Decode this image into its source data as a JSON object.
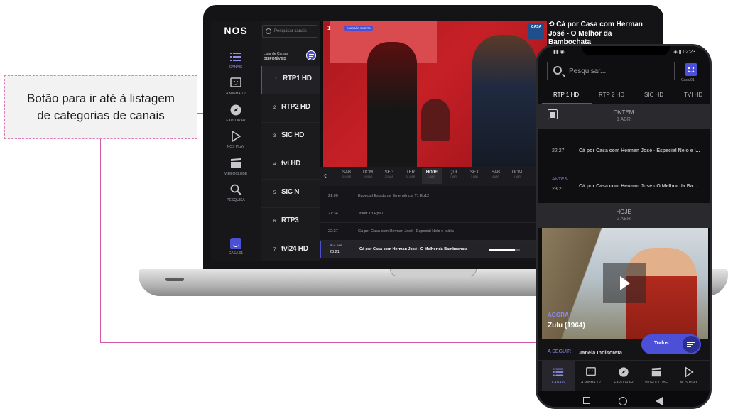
{
  "callout": {
    "text": "Botão para ir até à listagem\nde categorias de canais"
  },
  "laptop": {
    "brand": "NOS",
    "search_placeholder": "Pesquisar canais",
    "rail": [
      {
        "label": "CANAIS",
        "icon": "list-icon",
        "active": true
      },
      {
        "label": "A MINHA TV",
        "icon": "tv-face-icon",
        "active": false
      },
      {
        "label": "EXPLORAR",
        "icon": "compass-icon",
        "active": false
      },
      {
        "label": "NOS PLAY",
        "icon": "play-icon",
        "active": false
      },
      {
        "label": "VIDEOCLUBE",
        "icon": "clapper-icon",
        "active": false
      },
      {
        "label": "PESQUISA",
        "icon": "search-icon",
        "active": false
      }
    ],
    "profile_label": "CASA 01",
    "list_title": "Lista de Canais",
    "list_subtitle": "DISPONÍVEIS",
    "channels": [
      {
        "num": "1",
        "name": "RTP1 HD"
      },
      {
        "num": "2",
        "name": "RTP2 HD"
      },
      {
        "num": "3",
        "name": "SIC HD"
      },
      {
        "num": "4",
        "name": "tvi HD"
      },
      {
        "num": "5",
        "name": "SIC N"
      },
      {
        "num": "6",
        "name": "RTP3"
      },
      {
        "num": "7",
        "name": "tvi24 HD"
      }
    ],
    "video": {
      "channel_num": "1",
      "chip": "EMISSÃO DIRETA",
      "logo": "CASA"
    },
    "days": [
      {
        "name": "SÁB",
        "date": "28 MAR"
      },
      {
        "name": "DOM",
        "date": "29 MAR"
      },
      {
        "name": "SEG",
        "date": "30 MAR"
      },
      {
        "name": "TER",
        "date": "31 MAR"
      },
      {
        "name": "HOJE",
        "date": "1 ABR"
      },
      {
        "name": "QUI",
        "date": "2 ABR"
      },
      {
        "name": "SEX",
        "date": "3 ABR"
      },
      {
        "name": "SÁB",
        "date": "4 ABR"
      },
      {
        "name": "DOM",
        "date": "5 ABR"
      }
    ],
    "guide": [
      {
        "time": "21:00",
        "title": "Especial Estado de Emergência   T1 Ep12"
      },
      {
        "time": "21:34",
        "title": "Joker   T3 Ep91"
      },
      {
        "time": "22:27",
        "title": "Cá por Casa com Herman José - Especial Nelo e Idália"
      }
    ],
    "now": {
      "label": "AGORA",
      "time": "23:21",
      "title": "Cá por Casa com Herman José - O Melhor da Bambochata",
      "progress": 0.85
    },
    "side_title": "Cá por Casa com Herman José - O Melhor da Bambochata"
  },
  "phone": {
    "status_left": "▮▮ ◉",
    "status_right": "◈ ▮ 02:23",
    "search_placeholder": "Pesquisar...",
    "profile_label": "Casa 01",
    "tabs": [
      "RTP 1 HD",
      "RTP 2 HD",
      "SIC HD",
      "TVI HD"
    ],
    "day_yesterday": {
      "name": "ONTEM",
      "date": "1 ABR"
    },
    "prog1": {
      "time": "22:27",
      "title": "Cá por Casa com Herman José - Especial Nelo e I..."
    },
    "prog2": {
      "label": "ANTES",
      "time": "23:21",
      "title": "Cá por Casa com Herman José - O Melhor da Ba..."
    },
    "day_today": {
      "name": "HOJE",
      "date": "2 ABR"
    },
    "now": {
      "label": "AGORA",
      "title": "Zulu (1964)"
    },
    "next": {
      "label": "A SEGUIR",
      "title": "Janela Indiscreta"
    },
    "filter_label": "Todos",
    "nav": [
      {
        "label": "CANAIS",
        "icon": "list-icon",
        "active": true
      },
      {
        "label": "A MINHA TV",
        "icon": "tv-face-icon",
        "active": false
      },
      {
        "label": "EXPLORAR",
        "icon": "compass-icon",
        "active": false
      },
      {
        "label": "VIDEOCLUBE",
        "icon": "clapper-icon",
        "active": false
      },
      {
        "label": "NOS PLAY",
        "icon": "play-icon",
        "active": false
      }
    ],
    "system_nav": [
      "square-icon",
      "circle-icon",
      "back-triangle-icon"
    ],
    "accent": "#4b50d6"
  }
}
